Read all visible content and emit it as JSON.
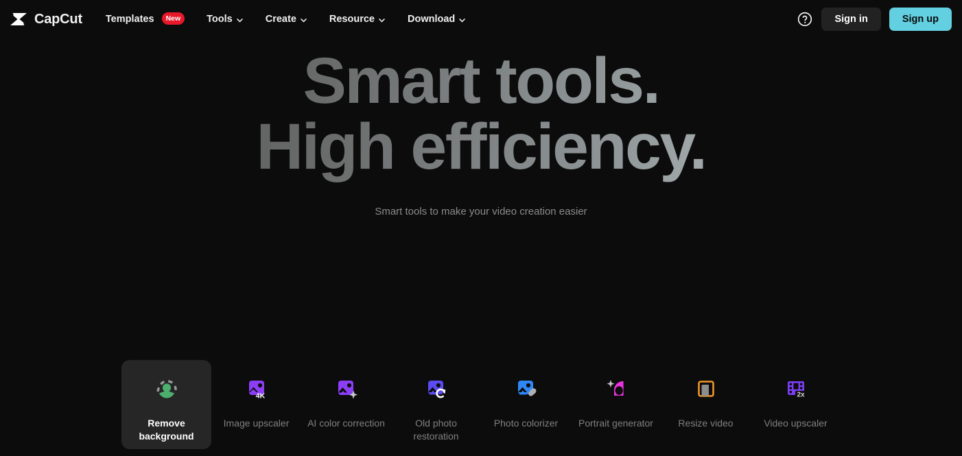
{
  "nav": {
    "brand": {
      "name": "CapCut",
      "icon": "capcut-logo-icon"
    },
    "items": [
      {
        "label": "Templates",
        "badge": "New",
        "has_chevron": false
      },
      {
        "label": "Tools",
        "badge": null,
        "has_chevron": true
      },
      {
        "label": "Create",
        "badge": null,
        "has_chevron": true
      },
      {
        "label": "Resource",
        "badge": null,
        "has_chevron": true
      },
      {
        "label": "Download",
        "badge": null,
        "has_chevron": true
      }
    ],
    "help_icon": "question-circle-icon",
    "sign_in_label": "Sign in",
    "sign_up_label": "Sign up"
  },
  "hero": {
    "line1": "Smart tools.",
    "line2": "High efficiency.",
    "subtitle": "Smart tools to make your video creation easier"
  },
  "tools": [
    {
      "label": "Remove background",
      "icon": "remove-background-icon",
      "active": true,
      "color": "#4caf6e"
    },
    {
      "label": "Image upscaler",
      "icon": "image-upscaler-icon",
      "active": false,
      "color": "#8b3ef5",
      "badge": "4K"
    },
    {
      "label": "AI color correction",
      "icon": "ai-color-correction-icon",
      "active": false,
      "color": "#8b3ef5"
    },
    {
      "label": "Old photo restoration",
      "icon": "old-photo-restoration-icon",
      "active": false,
      "color": "#5b4bf0"
    },
    {
      "label": "Photo colorizer",
      "icon": "photo-colorizer-icon",
      "active": false,
      "color": "#2f87f5"
    },
    {
      "label": "Portrait generator",
      "icon": "portrait-generator-icon",
      "active": false,
      "color": "#e933e0"
    },
    {
      "label": "Resize video",
      "icon": "resize-video-icon",
      "active": false,
      "color": "#f0962a"
    },
    {
      "label": "Video upscaler",
      "icon": "video-upscaler-icon",
      "active": false,
      "color": "#7b3ef5",
      "badge": "2x"
    }
  ],
  "colors": {
    "background": "#0c0c0c",
    "signup_accent": "#62d0e0",
    "badge_red": "#e8182b",
    "active_card": "#262626"
  }
}
